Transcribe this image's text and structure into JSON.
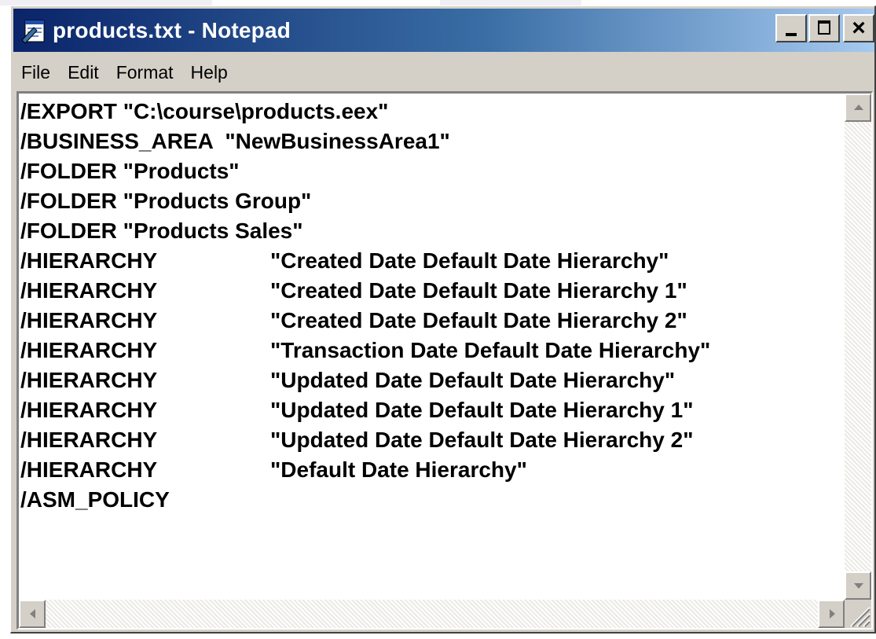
{
  "window": {
    "title": "products.txt - Notepad",
    "close_glyph": "×"
  },
  "menu": [
    "File",
    "Edit",
    "Format",
    "Help"
  ],
  "document": {
    "lines": [
      {
        "cmd": "/EXPORT \"C:\\course\\products.eex\"",
        "arg": ""
      },
      {
        "cmd": "/BUSINESS_AREA  \"NewBusinessArea1\"",
        "arg": ""
      },
      {
        "cmd": "/FOLDER \"Products\"",
        "arg": ""
      },
      {
        "cmd": "/FOLDER \"Products Group\"",
        "arg": ""
      },
      {
        "cmd": "/FOLDER \"Products Sales\"",
        "arg": ""
      },
      {
        "cmd": "/HIERARCHY",
        "arg": "\"Created Date Default Date Hierarchy\""
      },
      {
        "cmd": "/HIERARCHY",
        "arg": "\"Created Date Default Date Hierarchy 1\""
      },
      {
        "cmd": "/HIERARCHY",
        "arg": "\"Created Date Default Date Hierarchy 2\""
      },
      {
        "cmd": "/HIERARCHY",
        "arg": "\"Transaction Date Default Date Hierarchy\""
      },
      {
        "cmd": "/HIERARCHY",
        "arg": "\"Updated Date Default Date Hierarchy\""
      },
      {
        "cmd": "/HIERARCHY",
        "arg": "\"Updated Date Default Date Hierarchy 1\""
      },
      {
        "cmd": "/HIERARCHY",
        "arg": "\"Updated Date Default Date Hierarchy 2\""
      },
      {
        "cmd": "/HIERARCHY",
        "arg": "\"Default Date Hierarchy\""
      },
      {
        "cmd": "/ASM_POLICY",
        "arg": ""
      }
    ]
  },
  "icons": {
    "app": "notepad-icon",
    "minimize": "minimize-icon",
    "maximize": "maximize-icon",
    "close": "close-icon"
  },
  "colors": {
    "titlebar_start": "#0a246a",
    "titlebar_end": "#a6caf0",
    "chrome": "#d4d0c8"
  }
}
